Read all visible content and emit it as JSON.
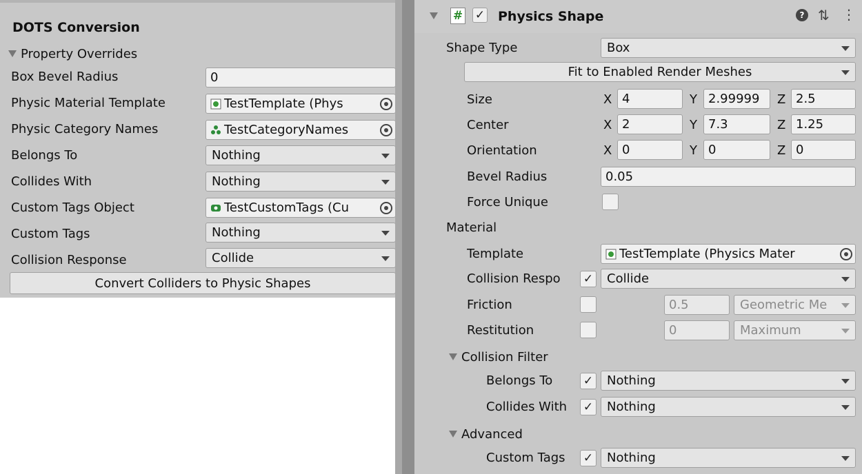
{
  "left": {
    "title": "DOTS Conversion",
    "foldout": "Property Overrides",
    "rows": {
      "bevel": {
        "label": "Box Bevel Radius",
        "value": "0"
      },
      "material": {
        "label": "Physic Material Template",
        "value": "TestTemplate (Phys"
      },
      "category": {
        "label": "Physic Category Names",
        "value": "TestCategoryNames"
      },
      "belongs": {
        "label": "Belongs To",
        "value": "Nothing"
      },
      "collides": {
        "label": "Collides With",
        "value": "Nothing"
      },
      "tagsobj": {
        "label": "Custom Tags Object",
        "value": "TestCustomTags (Cu"
      },
      "tags": {
        "label": "Custom Tags",
        "value": "Nothing"
      },
      "response": {
        "label": "Collision Response",
        "value": "Collide"
      }
    },
    "convert_button": "Convert Colliders to Physic Shapes"
  },
  "right": {
    "header": {
      "title": "Physics Shape",
      "enabled_check": "✓",
      "script_icon": "#",
      "help_icon": "❓",
      "settings_icon": "⇅",
      "menu_icon": "⋮"
    },
    "shape_type": {
      "label": "Shape Type",
      "value": "Box"
    },
    "fit_button": "Fit to Enabled Render Meshes",
    "size": {
      "label": "Size",
      "x": "4",
      "y": "2.99999",
      "z": "2.5"
    },
    "center": {
      "label": "Center",
      "x": "2",
      "y": "7.3",
      "z": "1.25"
    },
    "orientation": {
      "label": "Orientation",
      "x": "0",
      "y": "0",
      "z": "0"
    },
    "axis_labels": {
      "x": "X",
      "y": "Y",
      "z": "Z"
    },
    "bevel": {
      "label": "Bevel Radius",
      "value": "0.05"
    },
    "force_unique": {
      "label": "Force Unique"
    },
    "material_header": "Material",
    "template": {
      "label": "Template",
      "value": "TestTemplate (Physics Mater"
    },
    "collision_response": {
      "label": "Collision Respo",
      "check": "✓",
      "value": "Collide"
    },
    "friction": {
      "label": "Friction",
      "value": "0.5",
      "combine": "Geometric Me"
    },
    "restitution": {
      "label": "Restitution",
      "value": "0",
      "combine": "Maximum"
    },
    "collision_filter": {
      "header": "Collision Filter",
      "belongs_label": "Belongs To",
      "belongs_check": "✓",
      "belongs_value": "Nothing",
      "collides_label": "Collides With",
      "collides_check": "✓",
      "collides_value": "Nothing"
    },
    "advanced": {
      "header": "Advanced",
      "tags_label": "Custom Tags",
      "tags_check": "✓",
      "tags_value": "Nothing"
    }
  }
}
